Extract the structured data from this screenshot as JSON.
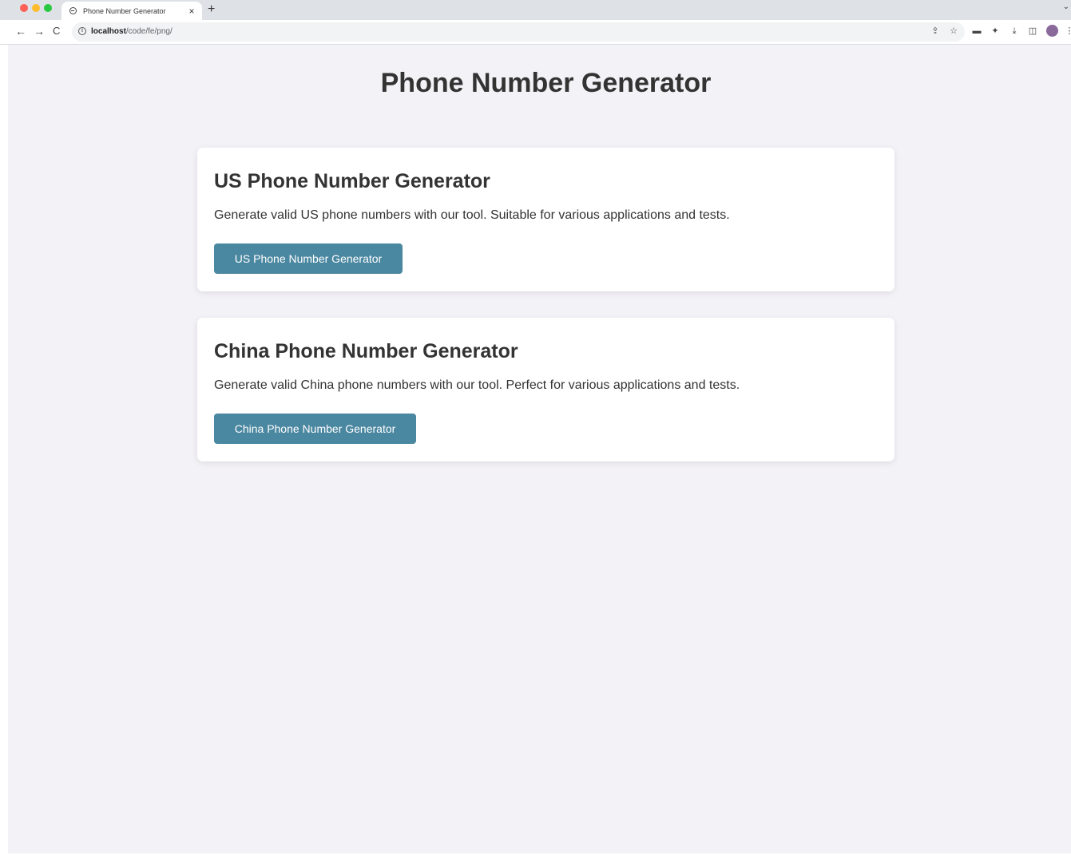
{
  "browser": {
    "tab_title": "Phone Number Generator",
    "tab_close": "×",
    "new_tab": "+",
    "url_host": "localhost",
    "url_path": "/code/fe/png/",
    "nav_back": "←",
    "nav_forward": "→",
    "nav_reload": "C",
    "icons": [
      "share-icon",
      "star-icon",
      "extension-icon",
      "puzzle-icon",
      "download-icon",
      "sidepanel-icon",
      "avatar",
      "menu-icon"
    ]
  },
  "page": {
    "title": "Phone Number Generator",
    "background": "#f3f2f7",
    "accent": "#4a87a0"
  },
  "cards": [
    {
      "title": "US Phone Number Generator",
      "description": "Generate valid US phone numbers with our tool. Suitable for various applications and tests.",
      "button_label": "US Phone Number Generator"
    },
    {
      "title": "China Phone Number Generator",
      "description": "Generate valid China phone numbers with our tool. Perfect for various applications and tests.",
      "button_label": "China Phone Number Generator"
    }
  ]
}
